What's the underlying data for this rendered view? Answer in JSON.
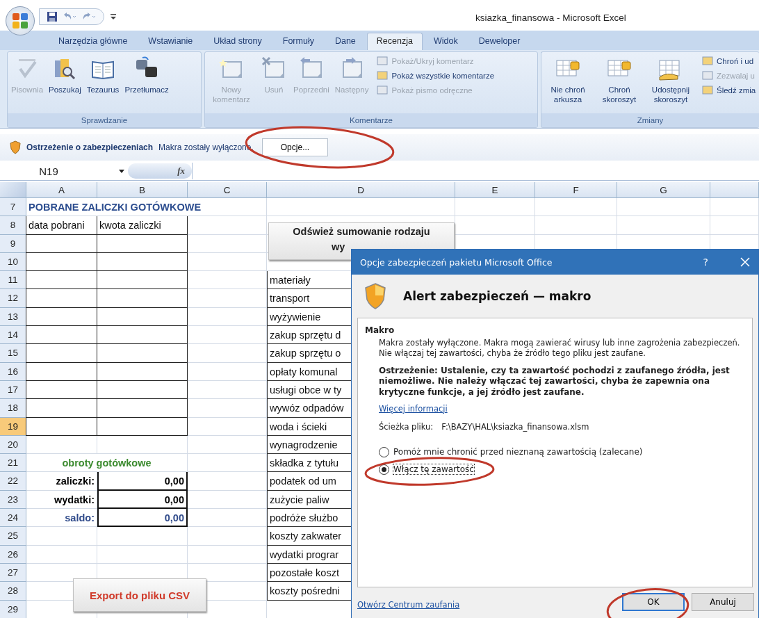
{
  "window": {
    "title": "ksiazka_finansowa - Microsoft Excel"
  },
  "tabs": [
    {
      "label": "Narzędzia główne",
      "selected": false
    },
    {
      "label": "Wstawianie",
      "selected": false
    },
    {
      "label": "Układ strony",
      "selected": false
    },
    {
      "label": "Formuły",
      "selected": false
    },
    {
      "label": "Dane",
      "selected": false
    },
    {
      "label": "Recenzja",
      "selected": true
    },
    {
      "label": "Widok",
      "selected": false
    },
    {
      "label": "Deweloper",
      "selected": false
    }
  ],
  "ribbon": [
    {
      "name": "Sprawdzanie",
      "buttons": [
        {
          "label": "Pisownia",
          "disabled": true
        },
        {
          "label": "Poszukaj",
          "disabled": false
        },
        {
          "label": "Tezaurus",
          "disabled": false
        },
        {
          "label": "Przetłumacz",
          "disabled": false
        }
      ]
    },
    {
      "name": "Komentarze",
      "buttons": [
        {
          "label": "Nowy komentarz",
          "disabled": true
        },
        {
          "label": "Usuń",
          "disabled": true
        },
        {
          "label": "Poprzedni",
          "disabled": true
        },
        {
          "label": "Następny",
          "disabled": true
        }
      ],
      "small": [
        {
          "label": "Pokaż/Ukryj komentarz",
          "disabled": true
        },
        {
          "label": "Pokaż wszystkie komentarze",
          "disabled": false
        },
        {
          "label": "Pokaż pismo odręczne",
          "disabled": true
        }
      ]
    },
    {
      "name": "Zmiany",
      "buttons": [
        {
          "label": "Nie chroń arkusza",
          "disabled": false
        },
        {
          "label": "Chroń skoroszyt",
          "disabled": false
        },
        {
          "label": "Udostępnij skoroszyt",
          "disabled": false
        }
      ],
      "small": [
        {
          "label": "Chroń i ud",
          "disabled": false
        },
        {
          "label": "Zezwalaj u",
          "disabled": true
        },
        {
          "label": "Śledź zmia",
          "disabled": false
        }
      ]
    }
  ],
  "security_bar": {
    "title": "Ostrzeżenie o zabezpieczeniach",
    "message": "Makra zostały wyłączone.",
    "button": "Opcje..."
  },
  "formula_bar": {
    "name_box": "N19",
    "fx": "fx"
  },
  "columns": [
    "A",
    "B",
    "C",
    "D",
    "E",
    "F",
    "G"
  ],
  "rows": [
    {
      "number": "7",
      "kind": "title",
      "selected": false,
      "a": "POBRANE ZALICZKI GOTÓWKOWE"
    },
    {
      "number": "8",
      "kind": "entry",
      "selected": false,
      "a": "data pobrani",
      "b": "kwota zaliczki"
    },
    {
      "number": "9",
      "kind": "entry",
      "selected": false
    },
    {
      "number": "10",
      "kind": "entry",
      "selected": false
    },
    {
      "number": "11",
      "kind": "entry",
      "selected": false,
      "d": "materiały"
    },
    {
      "number": "12",
      "kind": "entry",
      "selected": false,
      "d": "transport"
    },
    {
      "number": "13",
      "kind": "entry",
      "selected": false,
      "d": "wyżywienie"
    },
    {
      "number": "14",
      "kind": "entry",
      "selected": false,
      "d": "zakup sprzętu d"
    },
    {
      "number": "15",
      "kind": "entry",
      "selected": false,
      "d": "zakup sprzętu o"
    },
    {
      "number": "16",
      "kind": "entry",
      "selected": false,
      "d": "opłaty komunal"
    },
    {
      "number": "17",
      "kind": "entry",
      "selected": false,
      "d": "usługi obce w ty"
    },
    {
      "number": "18",
      "kind": "entry",
      "selected": false,
      "d": "wywóz odpadów"
    },
    {
      "number": "19",
      "kind": "entry",
      "selected": true,
      "d": "woda i ścieki"
    },
    {
      "number": "20",
      "kind": "plain",
      "selected": false,
      "d": "wynagrodzenie"
    },
    {
      "number": "21",
      "kind": "subtitle",
      "selected": false,
      "a": "obroty gotówkowe",
      "d": "składka z tytułu"
    },
    {
      "number": "22",
      "kind": "total",
      "selected": false,
      "color": "#000000",
      "label": "zaliczki:",
      "value": "0,00",
      "d": "podatek od um"
    },
    {
      "number": "23",
      "kind": "total",
      "selected": false,
      "color": "#000000",
      "label": "wydatki:",
      "value": "0,00",
      "d": "zużycie paliw"
    },
    {
      "number": "24",
      "kind": "total",
      "selected": false,
      "color": "#2f4a8a",
      "label": "saldo:",
      "value": "0,00",
      "d": "podróże służbo"
    },
    {
      "number": "25",
      "kind": "plain",
      "selected": false,
      "d": "koszty zakwater"
    },
    {
      "number": "26",
      "kind": "plain",
      "selected": false,
      "d": "wydatki prograr"
    },
    {
      "number": "27",
      "kind": "plain",
      "selected": false,
      "d": "pozostałe koszt"
    },
    {
      "number": "28",
      "kind": "plain",
      "selected": false,
      "d": "koszty pośredni"
    },
    {
      "number": "29",
      "kind": "plain",
      "selected": false
    }
  ],
  "sheet_buttons": [
    {
      "kind": "refresh",
      "lines": [
        "Odśwież sumowanie rodzaju",
        "wy"
      ]
    },
    {
      "kind": "export",
      "lines": [
        "Export do pliku CSV"
      ]
    }
  ],
  "dialog": {
    "title": "Opcje zabezpieczeń pakietu Microsoft Office",
    "help": "?",
    "heading": "Alert zabezpieczeń — makro",
    "section": "Makro",
    "description": "Makra zostały wyłączone. Makra mogą zawierać wirusy lub inne zagrożenia zabezpieczeń. Nie włączaj tej zawartości, chyba że źródło tego pliku jest zaufane.",
    "warning": "Ostrzeżenie: Ustalenie, czy ta zawartość pochodzi z zaufanego źródła, jest niemożliwe. Nie należy włączać tej zawartości, chyba że zapewnia ona krytyczne funkcje, a jej źródło jest zaufane.",
    "link": "Więcej informacji",
    "path_label": "Ścieżka pliku:",
    "path": "F:\\BAZY\\HAL\\ksiazka_finansowa.xlsm",
    "options": [
      {
        "label": "Pomóż mnie chronić przed nieznaną zawartością (zalecane)",
        "selected": false
      },
      {
        "label": "Włącz tę zawartość",
        "selected": true
      }
    ],
    "footer_link": "Otwórz Centrum zaufania",
    "buttons": [
      {
        "label": "OK",
        "default": true
      },
      {
        "label": "Anuluj",
        "default": false
      }
    ]
  }
}
